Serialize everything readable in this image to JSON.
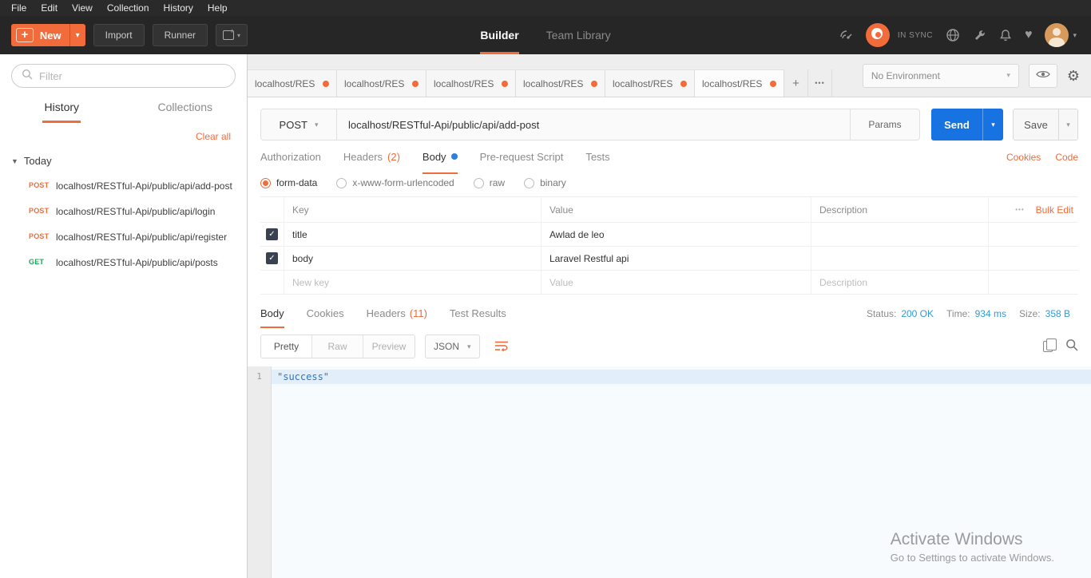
{
  "colors": {
    "accent_orange": "#f26b3a",
    "send_blue": "#1673e1",
    "status_blue": "#2e9bd6",
    "get_green": "#1ea45c",
    "post_orange": "#f26b3a"
  },
  "icons": {
    "caret": "▾",
    "plus": "+",
    "check": "✓",
    "ellipsis": "•••",
    "dots": "•••",
    "gear": "⚙",
    "heart": "♥",
    "collapse": "▼"
  },
  "menubar": {
    "items": [
      "File",
      "Edit",
      "View",
      "Collection",
      "History",
      "Help"
    ]
  },
  "toolbar": {
    "new_label": "New",
    "import_label": "Import",
    "runner_label": "Runner",
    "nav": [
      {
        "label": "Builder"
      },
      {
        "label": "Team Library"
      }
    ],
    "sync_status": "IN SYNC"
  },
  "sidebar": {
    "filter_placeholder": "Filter",
    "tabs": [
      {
        "label": "History"
      },
      {
        "label": "Collections"
      }
    ],
    "clear_all_label": "Clear all",
    "group_label": "Today",
    "items": [
      {
        "method": "POST",
        "url": "localhost/RESTful-Api/public/api/add-post"
      },
      {
        "method": "POST",
        "url": "localhost/RESTful-Api/public/api/login"
      },
      {
        "method": "POST",
        "url": "localhost/RESTful-Api/public/api/register"
      },
      {
        "method": "GET",
        "url": "localhost/RESTful-Api/public/api/posts"
      }
    ]
  },
  "tab_strip": {
    "tabs": [
      "localhost/RES",
      "localhost/RES",
      "localhost/RES",
      "localhost/RES",
      "localhost/RES",
      "localhost/RES"
    ],
    "add_label": "+",
    "environment": "No Environment"
  },
  "request": {
    "method": "POST",
    "url": "localhost/RESTful-Api/public/api/add-post",
    "params_label": "Params",
    "send_label": "Send",
    "save_label": "Save",
    "tabs": [
      {
        "label": "Authorization"
      },
      {
        "label": "Headers",
        "count": "(2)"
      },
      {
        "label": "Body"
      },
      {
        "label": "Pre-request Script"
      },
      {
        "label": "Tests"
      }
    ],
    "cookies_label": "Cookies",
    "code_label": "Code",
    "body_modes": [
      {
        "label": "form-data",
        "selected": true
      },
      {
        "label": "x-www-form-urlencoded"
      },
      {
        "label": "raw"
      },
      {
        "label": "binary"
      }
    ],
    "table": {
      "headers": {
        "key": "Key",
        "value": "Value",
        "description": "Description"
      },
      "bulk_edit_label": "Bulk Edit",
      "rows": [
        {
          "key": "title",
          "value": "Awlad de leo",
          "description": "",
          "checked": true
        },
        {
          "key": "body",
          "value": "Laravel Restful api",
          "description": "",
          "checked": true
        }
      ],
      "placeholders": {
        "key": "New key",
        "value": "Value",
        "description": "Description"
      }
    }
  },
  "response": {
    "tabs": [
      {
        "label": "Body"
      },
      {
        "label": "Cookies"
      },
      {
        "label": "Headers",
        "count": "(11)"
      },
      {
        "label": "Test Results"
      }
    ],
    "status_label": "Status:",
    "status_value": "200 OK",
    "time_label": "Time:",
    "time_value": "934 ms",
    "size_label": "Size:",
    "size_value": "358 B",
    "view_modes": {
      "pretty": "Pretty",
      "raw": "Raw",
      "preview": "Preview"
    },
    "format": "JSON",
    "line_number": "1",
    "body_text": "\"success\""
  },
  "watermark": {
    "line1": "Activate Windows",
    "line2": "Go to Settings to activate Windows."
  }
}
